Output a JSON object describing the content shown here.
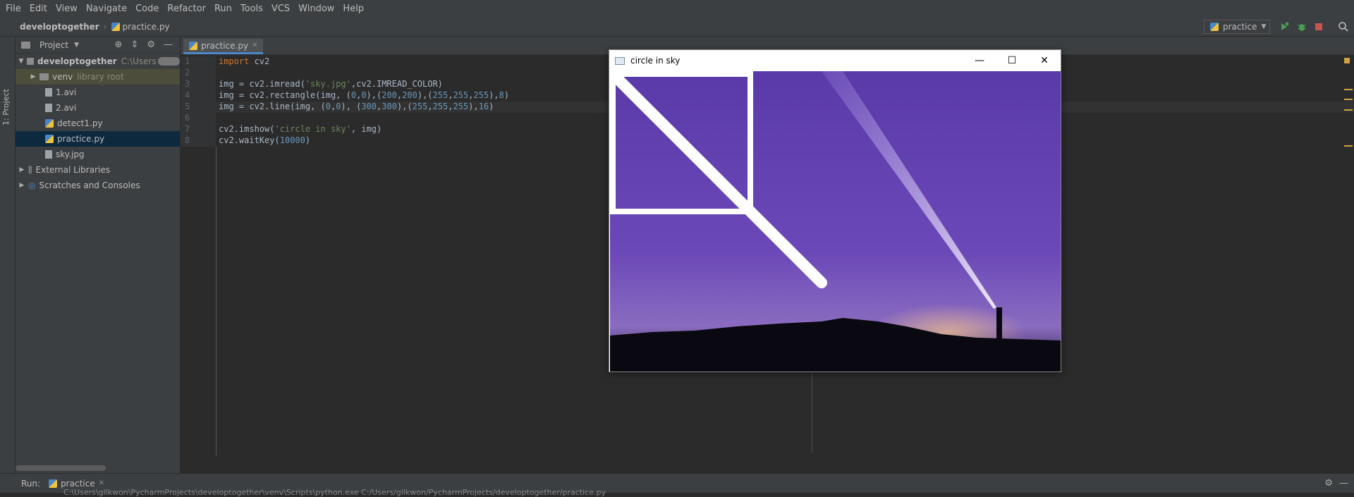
{
  "menu": [
    "File",
    "Edit",
    "View",
    "Navigate",
    "Code",
    "Refactor",
    "Run",
    "Tools",
    "VCS",
    "Window",
    "Help"
  ],
  "breadcrumb": {
    "project": "developtogether",
    "file": "practice.py"
  },
  "run_config": {
    "label": "practice"
  },
  "sidebar": {
    "tab_label": "1: Project"
  },
  "project_panel": {
    "title": "Project",
    "root": {
      "name": "developtogether",
      "path": "C:\\Users"
    },
    "items": [
      {
        "label": "venv",
        "note": "library root",
        "kind": "folder"
      },
      {
        "label": "1.avi",
        "kind": "file"
      },
      {
        "label": "2.avi",
        "kind": "file"
      },
      {
        "label": "detect1.py",
        "kind": "py"
      },
      {
        "label": "practice.py",
        "kind": "py"
      },
      {
        "label": "sky.jpg",
        "kind": "file"
      }
    ],
    "external_libraries": "External Libraries",
    "scratches": "Scratches and Consoles"
  },
  "editor": {
    "tab": "practice.py",
    "lines": [
      {
        "n": "1"
      },
      {
        "n": "2"
      },
      {
        "n": "3"
      },
      {
        "n": "4"
      },
      {
        "n": "5"
      },
      {
        "n": "6"
      },
      {
        "n": "7"
      },
      {
        "n": "8"
      }
    ],
    "code": {
      "l1_kw": "import",
      "l1_rest": " cv2",
      "l3_a": "img = cv2.imread(",
      "l3_str": "'sky.jpg'",
      "l3_b": ",cv2.IMREAD_COLOR)",
      "l4_a": "img = cv2.rectangle(img, (",
      "l4_n1": "0",
      "l4_c1": ",",
      "l4_n2": "0",
      "l4_b": "),(",
      "l4_n3": "200",
      "l4_c2": ",",
      "l4_n4": "200",
      "l4_c": "),(",
      "l4_n5": "255",
      "l4_c3": ",",
      "l4_n6": "255",
      "l4_c4": ",",
      "l4_n7": "255",
      "l4_d": "),",
      "l4_n8": "8",
      "l4_e": ")",
      "l5_a": "img = cv2.line(img, (",
      "l5_n1": "0",
      "l5_c1": ",",
      "l5_n2": "0",
      "l5_b": "), (",
      "l5_n3": "300",
      "l5_c2": ",",
      "l5_n4": "300",
      "l5_c": "),(",
      "l5_n5": "255",
      "l5_c3": ",",
      "l5_n6": "255",
      "l5_c4": ",",
      "l5_n7": "255",
      "l5_d": "),",
      "l5_n8": "16",
      "l5_e": ")",
      "l7_a": "cv2.imshow(",
      "l7_str": "'circle in sky'",
      "l7_b": ", img)",
      "l8_a": "cv2.waitKey(",
      "l8_num": "10000",
      "l8_b": ")"
    }
  },
  "cv_window": {
    "title": "circle in sky"
  },
  "run_panel": {
    "label": "Run:",
    "tab": "practice",
    "output": "C:\\Users\\gilkwon\\PycharmProjects\\developtogether\\venv\\Scripts\\python.exe C:/Users/gilkwon/PycharmProjects/developtogether/practice.py"
  },
  "colors": {
    "accent": "#4a88c7",
    "bg": "#2b2b2b",
    "panel": "#3c3f41"
  }
}
